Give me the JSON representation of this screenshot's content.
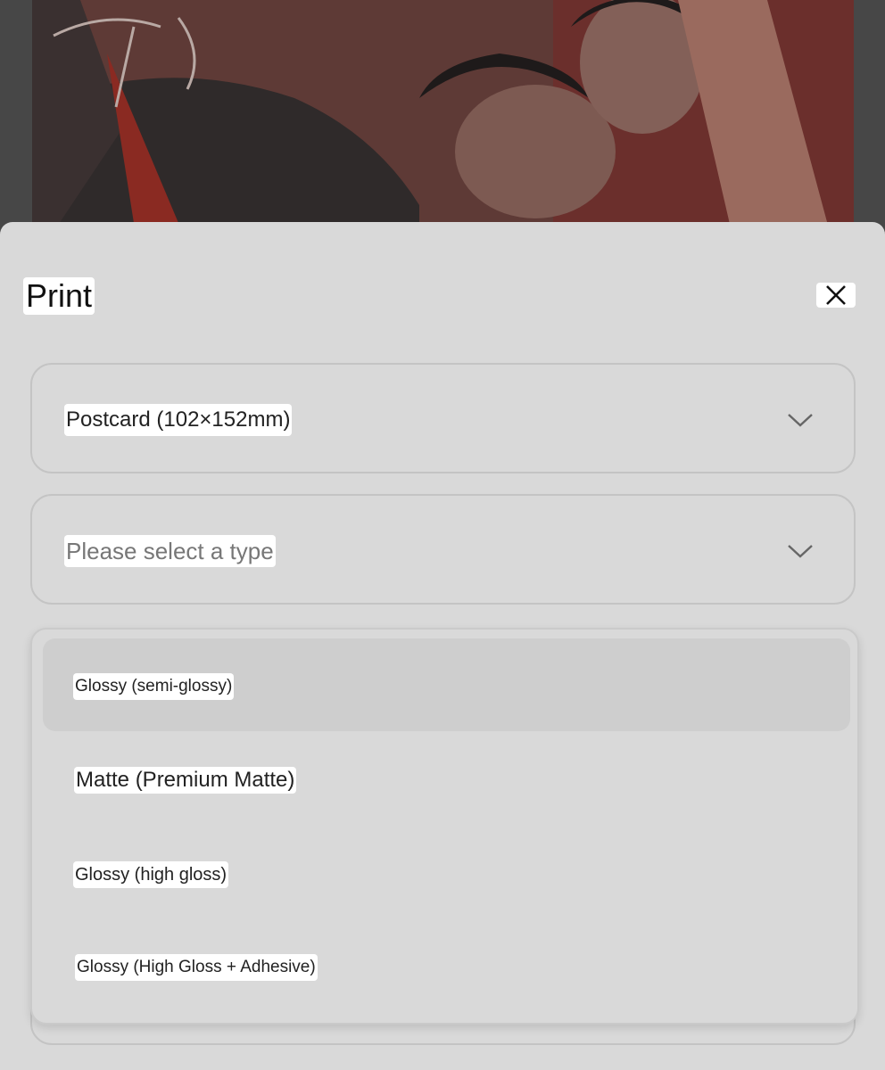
{
  "sheet": {
    "title": "Print"
  },
  "size_select": {
    "value": "Postcard (102×152mm)"
  },
  "type_select": {
    "placeholder": "Please select a type"
  },
  "dropdown": {
    "options": [
      {
        "label": "Glossy (semi-glossy)"
      },
      {
        "label": "Matte (Premium Matte)"
      },
      {
        "label": "Glossy (high gloss)"
      },
      {
        "label": "Glossy (High Gloss + Adhesive)"
      }
    ]
  },
  "colors": {
    "sheet_bg": "#d9d9d9",
    "overlay": "#5a5a5a",
    "artwork_red": "#6e2a2a"
  }
}
